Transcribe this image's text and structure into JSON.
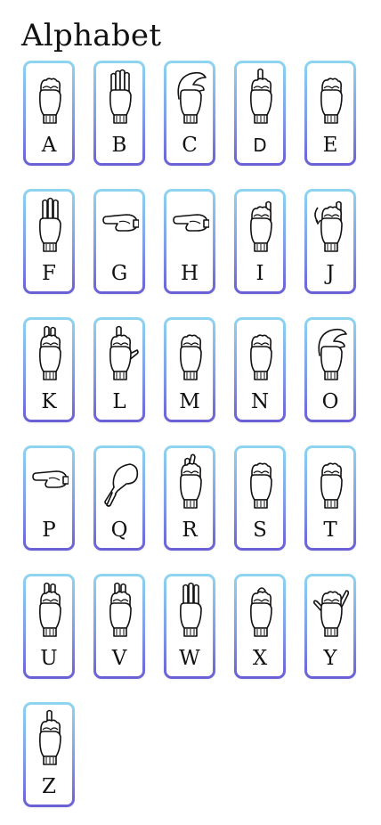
{
  "header": {
    "title": "Alphabet"
  },
  "letters": [
    {
      "label": "A",
      "pose": "fist"
    },
    {
      "label": "B",
      "pose": "flat"
    },
    {
      "label": "C",
      "pose": "curve"
    },
    {
      "label": "D",
      "pose": "index"
    },
    {
      "label": "E",
      "pose": "fist"
    },
    {
      "label": "F",
      "pose": "three"
    },
    {
      "label": "G",
      "pose": "point-side"
    },
    {
      "label": "H",
      "pose": "point-side"
    },
    {
      "label": "I",
      "pose": "pinky"
    },
    {
      "label": "J",
      "pose": "pinky-hook"
    },
    {
      "label": "K",
      "pose": "two"
    },
    {
      "label": "L",
      "pose": "ell"
    },
    {
      "label": "M",
      "pose": "fist"
    },
    {
      "label": "N",
      "pose": "fist"
    },
    {
      "label": "O",
      "pose": "curve"
    },
    {
      "label": "P",
      "pose": "point-side"
    },
    {
      "label": "Q",
      "pose": "point-down"
    },
    {
      "label": "R",
      "pose": "cross"
    },
    {
      "label": "S",
      "pose": "fist"
    },
    {
      "label": "T",
      "pose": "fist"
    },
    {
      "label": "U",
      "pose": "two"
    },
    {
      "label": "V",
      "pose": "two"
    },
    {
      "label": "W",
      "pose": "three"
    },
    {
      "label": "X",
      "pose": "hook"
    },
    {
      "label": "Y",
      "pose": "shaka"
    },
    {
      "label": "Z",
      "pose": "index"
    }
  ],
  "icons": {
    "hand": "hand-sign-icon"
  }
}
